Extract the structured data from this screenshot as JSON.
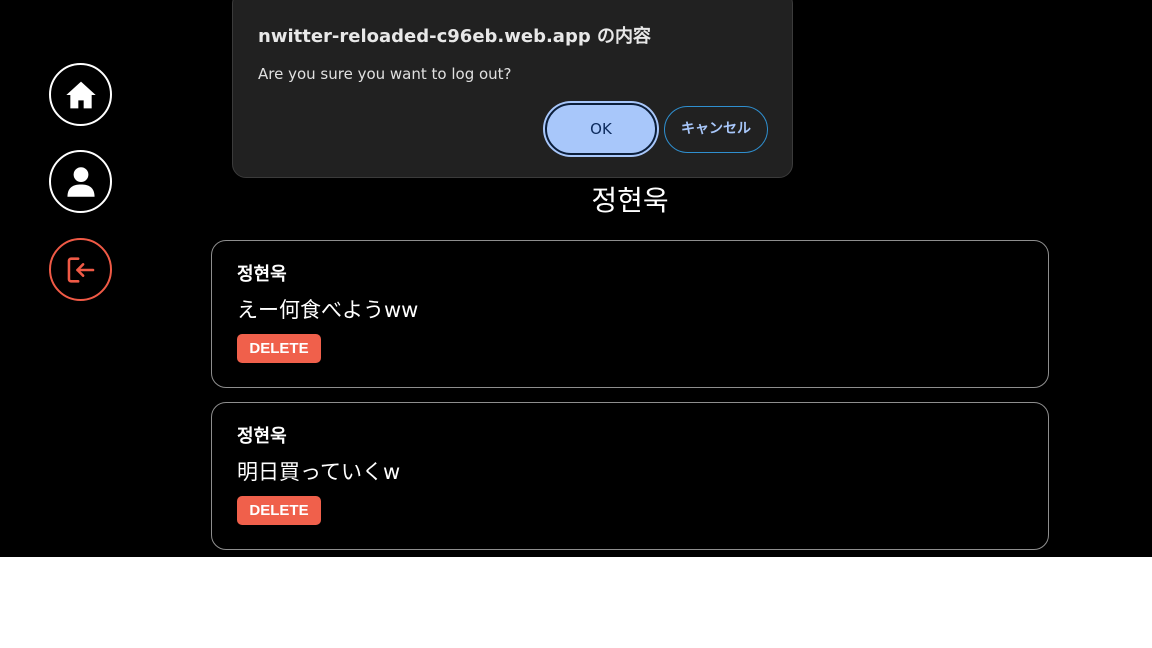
{
  "nav": {
    "items": [
      {
        "name": "home",
        "icon": "home-icon"
      },
      {
        "name": "profile",
        "icon": "user-icon"
      },
      {
        "name": "logout",
        "icon": "logout-icon",
        "color": "#f05a46"
      }
    ]
  },
  "profile": {
    "name": "정현욱"
  },
  "tweets": [
    {
      "username": "정현욱",
      "payload": "えー何食べようww",
      "delete_label": "DELETE"
    },
    {
      "username": "정현욱",
      "payload": "明日買っていくw",
      "delete_label": "DELETE"
    }
  ],
  "dialog": {
    "title": "nwitter-reloaded-c96eb.web.app の内容",
    "message": "Are you sure you want to log out?",
    "ok_label": "OK",
    "cancel_label": "キャンセル"
  },
  "colors": {
    "background": "#000000",
    "delete_button": "#f0604b",
    "logout_accent": "#f05a46",
    "dialog_bg": "#212121",
    "ok_button": "#a8c7fa"
  }
}
